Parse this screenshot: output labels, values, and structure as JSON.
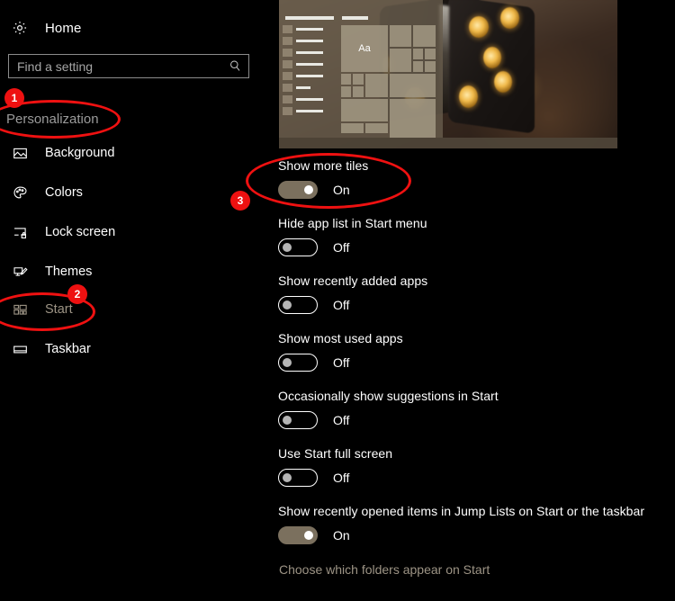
{
  "sidebar": {
    "home": {
      "label": "Home",
      "icon": "gear-icon"
    },
    "search": {
      "placeholder": "Find a setting",
      "icon": "search-icon"
    },
    "section_header": "Personalization",
    "items": [
      {
        "label": "Background",
        "icon": "picture-icon",
        "selected": false
      },
      {
        "label": "Colors",
        "icon": "palette-icon",
        "selected": false
      },
      {
        "label": "Lock screen",
        "icon": "lock-screen-icon",
        "selected": false
      },
      {
        "label": "Themes",
        "icon": "themes-icon",
        "selected": false
      },
      {
        "label": "Start",
        "icon": "start-tiles-icon",
        "selected": true
      },
      {
        "label": "Taskbar",
        "icon": "taskbar-icon",
        "selected": false
      }
    ]
  },
  "main": {
    "preview": {
      "name": "start-menu-preview",
      "tile_text": "Aa"
    },
    "settings": [
      {
        "label": "Show more tiles",
        "state": "On",
        "on": true
      },
      {
        "label": "Hide app list in Start menu",
        "state": "Off",
        "on": false
      },
      {
        "label": "Show recently added apps",
        "state": "Off",
        "on": false
      },
      {
        "label": "Show most used apps",
        "state": "Off",
        "on": false
      },
      {
        "label": "Occasionally show suggestions in Start",
        "state": "Off",
        "on": false
      },
      {
        "label": "Use Start full screen",
        "state": "Off",
        "on": false
      },
      {
        "label": "Show recently opened items in Jump Lists on Start or the taskbar",
        "state": "On",
        "on": true
      }
    ],
    "folders_link": "Choose which folders appear on Start"
  },
  "annotations": {
    "color": "#ee1111",
    "badges": [
      {
        "number": "1",
        "target": "Personalization"
      },
      {
        "number": "2",
        "target": "Start"
      },
      {
        "number": "3",
        "target": "Show more tiles"
      }
    ]
  },
  "colors": {
    "accent_toggle_on": "#7b705e",
    "link_text": "#9d9485",
    "background": "#000000",
    "annotation_red": "#ee1111"
  }
}
